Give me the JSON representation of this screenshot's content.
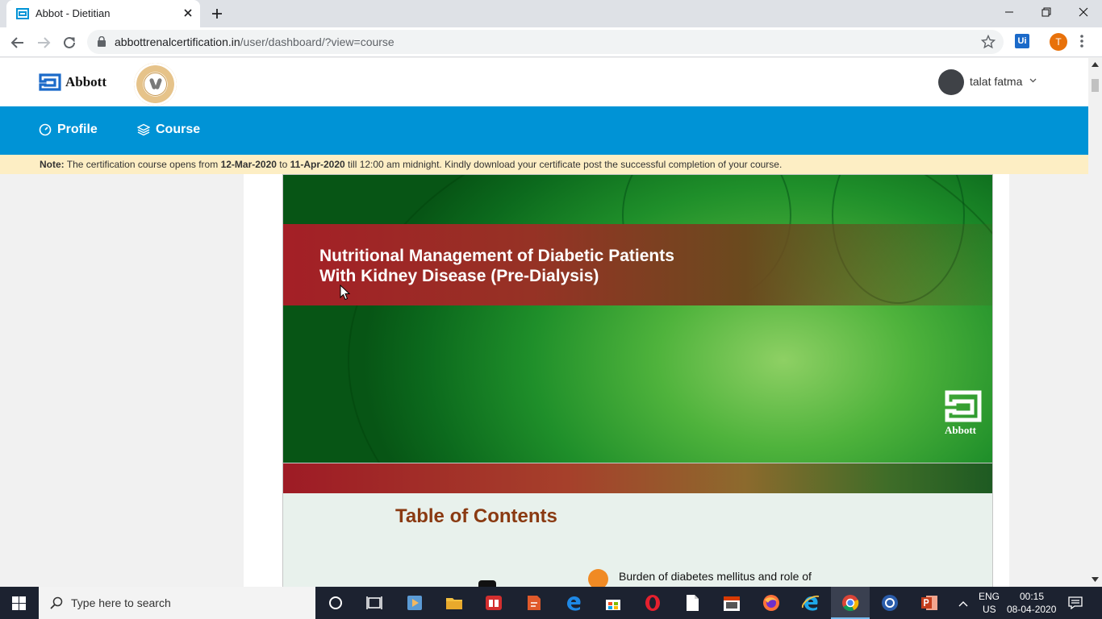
{
  "browser": {
    "tab_title": "Abbot - Dietitian",
    "url_domain": "abbottrenalcertification.in",
    "url_path": "/user/dashboard/?view=course",
    "ext_label": "Ui",
    "profile_initial": "T"
  },
  "header": {
    "brand": "Abbott",
    "user_name": "talat fatma"
  },
  "nav": {
    "profile_label": "Profile",
    "course_label": "Course"
  },
  "note": {
    "label": "Note:",
    "text1": "The certification course opens from",
    "date_open": "12-Mar-2020",
    "text2": "to",
    "date_close": "11-Apr-2020",
    "text3": "till 12:00 am midnight. Kindly download your certificate post the successful completion of your course."
  },
  "slide1": {
    "title_line1": "Nutritional Management of Diabetic Patients",
    "title_line2": "With Kidney Disease (Pre-Dialysis)",
    "logo_word": "Abbott"
  },
  "slide2": {
    "heading": "Table of Contents",
    "item1": "Burden of diabetes mellitus and role of"
  },
  "taskbar": {
    "search_placeholder": "Type here to search",
    "lang": "ENG",
    "region": "US",
    "time": "00:15",
    "date": "08-04-2020"
  },
  "colors": {
    "nav_blue": "#0093d6",
    "note_bg": "#fdeec4",
    "slide_red": "#a41f26",
    "slide_green": "#1f8f2a"
  }
}
